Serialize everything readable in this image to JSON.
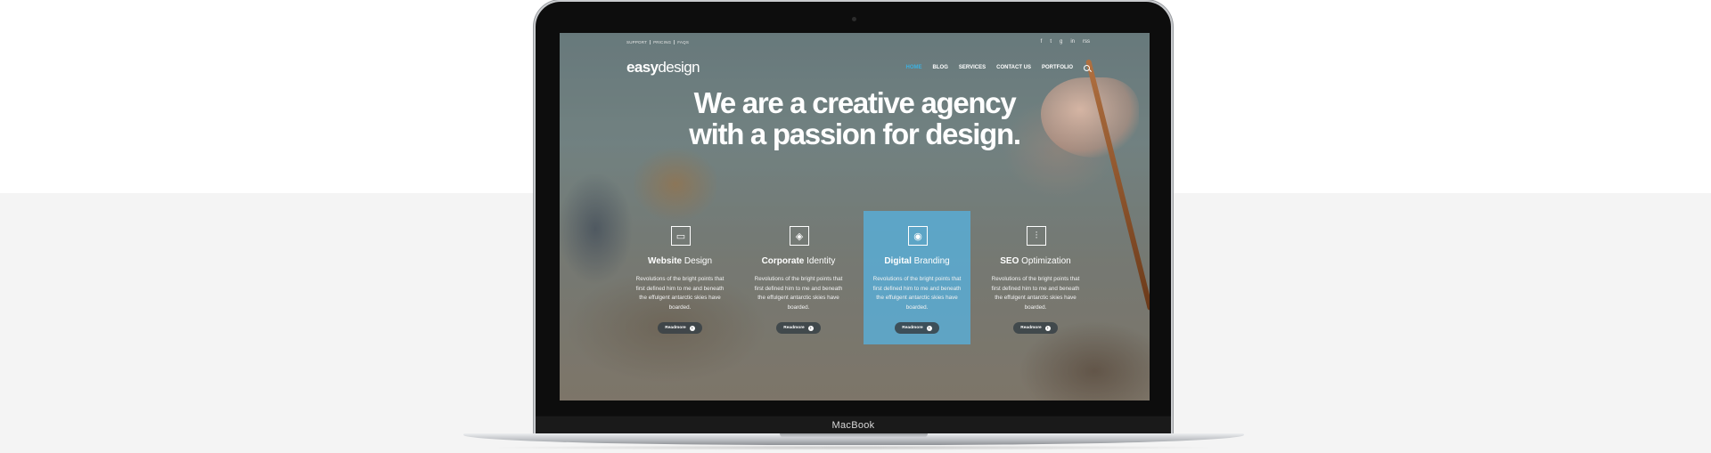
{
  "device_label": "MacBook",
  "site": {
    "top_links": [
      "SUPPORT",
      "PRICING",
      "FAQS"
    ],
    "social_icons": [
      "facebook-icon",
      "twitter-icon",
      "google-plus-icon",
      "linkedin-icon",
      "rss-icon"
    ],
    "social_glyphs": [
      "f",
      "t",
      "g",
      "in",
      "rss"
    ],
    "logo_bold": "easy",
    "logo_light": "design",
    "nav": [
      "HOME",
      "BLOG",
      "SERVICES",
      "CONTACT US",
      "PORTFOLIO"
    ],
    "nav_active": "HOME",
    "hero_line1": "We are a creative agency",
    "hero_line2": "with a passion for design.",
    "accent_color": "#3db1e0",
    "features": [
      {
        "bold": "Website",
        "light": "Design",
        "icon": "monitor-icon",
        "glyph": "▭",
        "desc": "Revolutions of the bright points that first defined him to me and beneath the effulgent antarctic skies have boarded.",
        "button": "Readmore"
      },
      {
        "bold": "Corporate",
        "light": "Identity",
        "icon": "layers-icon",
        "glyph": "◈",
        "desc": "Revolutions of the bright points that first defined him to me and beneath the effulgent antarctic skies have boarded.",
        "button": "Readmore"
      },
      {
        "bold": "Digital",
        "light": "Branding",
        "icon": "bulb-icon",
        "glyph": "◉",
        "desc": "Revolutions of the bright points that first defined him to me and beneath the effulgent antarctic skies have boarded.",
        "button": "Readmore"
      },
      {
        "bold": "SEO",
        "light": "Optimization",
        "icon": "equalizer-icon",
        "glyph": "⫶",
        "desc": "Revolutions of the bright points that first defined him to me and beneath the effulgent antarctic skies have boarded.",
        "button": "Readmore"
      }
    ]
  }
}
